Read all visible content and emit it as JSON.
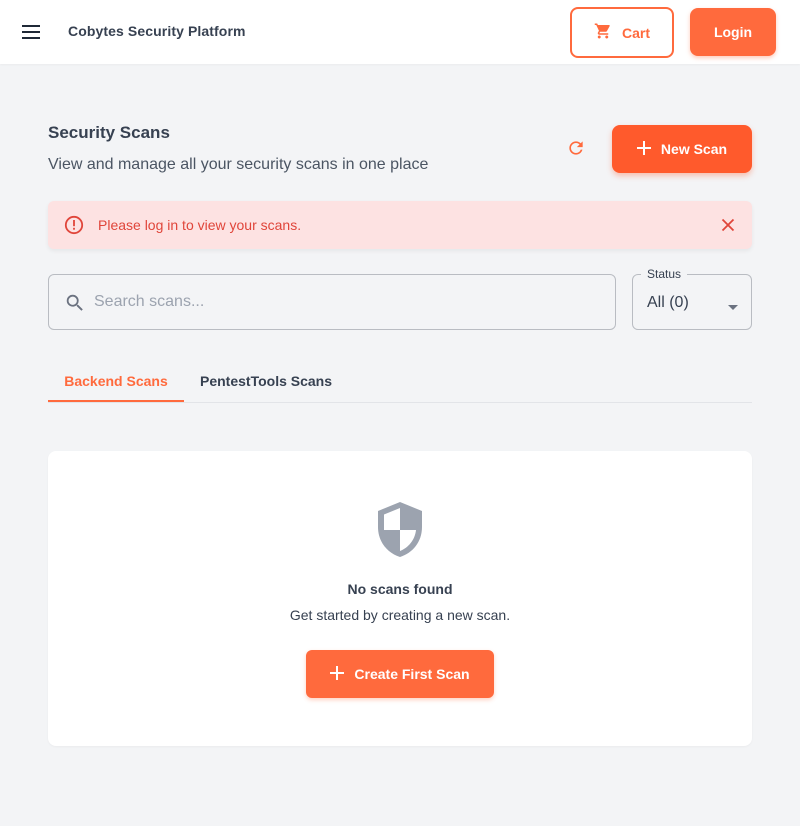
{
  "header": {
    "menu_icon": "hamburger-menu-icon",
    "app_title": "Cobytes Security Platform",
    "cart_label": "Cart",
    "cart_icon": "shopping-cart-icon",
    "login_label": "Login"
  },
  "page": {
    "title": "Security Scans",
    "subtitle": "View and manage all your security scans in one place",
    "refresh_icon": "refresh-icon",
    "new_scan_label": "New Scan"
  },
  "alert": {
    "message": "Please log in to view your scans.",
    "type": "error",
    "color": "#e0453a"
  },
  "filters": {
    "search_placeholder": "Search scans...",
    "search_value": "",
    "status_label": "Status",
    "status_value": "All (0)"
  },
  "tabs": [
    {
      "label": "Backend Scans",
      "active": true
    },
    {
      "label": "PentestTools Scans",
      "active": false
    }
  ],
  "empty_state": {
    "icon": "shield-icon",
    "title": "No scans found",
    "subtitle": "Get started by creating a new scan.",
    "cta_label": "Create First Scan"
  },
  "colors": {
    "accent": "#ff6a3d",
    "background": "#f3f4f6",
    "alert_background": "#fde2e2"
  }
}
